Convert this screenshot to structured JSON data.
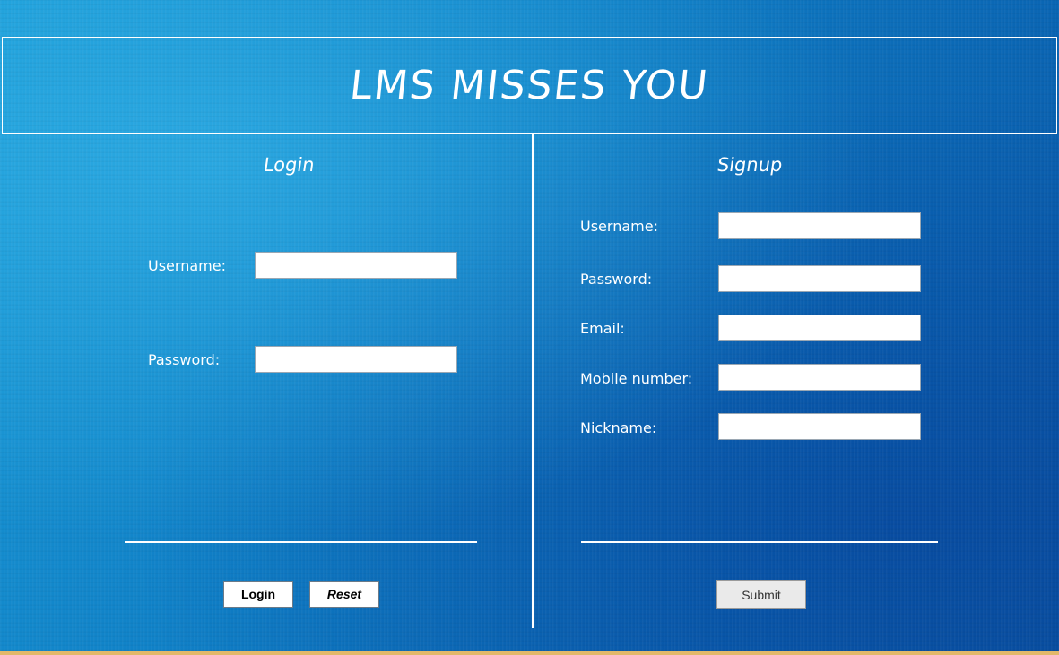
{
  "header": {
    "title": "LMS MISSES YOU"
  },
  "login": {
    "title": "Login",
    "username_label": "Username:",
    "username_value": "",
    "password_label": "Password:",
    "password_value": "",
    "login_button": "Login",
    "reset_button": "Reset"
  },
  "signup": {
    "title": "Signup",
    "username_label": "Username:",
    "username_value": "",
    "password_label": "Password:",
    "password_value": "",
    "email_label": "Email:",
    "email_value": "",
    "mobile_label": "Mobile number:",
    "mobile_value": "",
    "nickname_label": "Nickname:",
    "nickname_value": "",
    "submit_button": "Submit"
  },
  "colors": {
    "background": "#1282c8",
    "text": "#ffffff",
    "bottom_strip": "#e3b86a"
  }
}
